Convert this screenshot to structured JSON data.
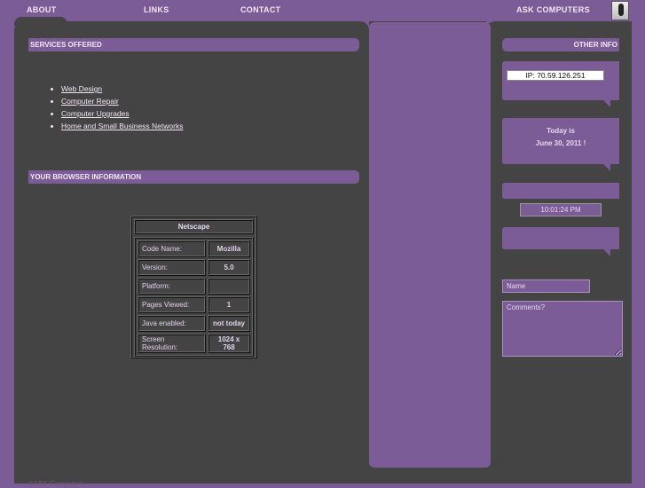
{
  "nav": {
    "about": "ABOUT",
    "links": "LINKS",
    "contact": "CONTACT",
    "ask": "ASK COMPUTERS"
  },
  "services": {
    "title": "SERVICES OFFERED",
    "items": [
      "Web Design",
      "Computer Repair",
      "Computer Upgrades",
      "Home and Small Business Networks"
    ]
  },
  "browser": {
    "title": "YOUR BROWSER INFORMATION",
    "name": "Netscape",
    "rows": [
      {
        "label": "Code Name:",
        "value": "Mozilla"
      },
      {
        "label": "Version:",
        "value": "5.0"
      },
      {
        "label": "Platform:",
        "value": ""
      },
      {
        "label": "Pages Viewed:",
        "value": "1"
      },
      {
        "label": "Java enabled:",
        "value": "not today"
      },
      {
        "label": "Screen Resolution:",
        "value": "1024 x 768"
      }
    ]
  },
  "other": {
    "title": "OTHER INFO",
    "ip": "IP: 70.59.126.251",
    "today_line1": "Today is",
    "today_line2": "June 30, 2011 !",
    "time": "10:01:24 PM",
    "name_placeholder": "Name",
    "comments_placeholder": "Comments?"
  },
  "footer": "©ASK Computers"
}
